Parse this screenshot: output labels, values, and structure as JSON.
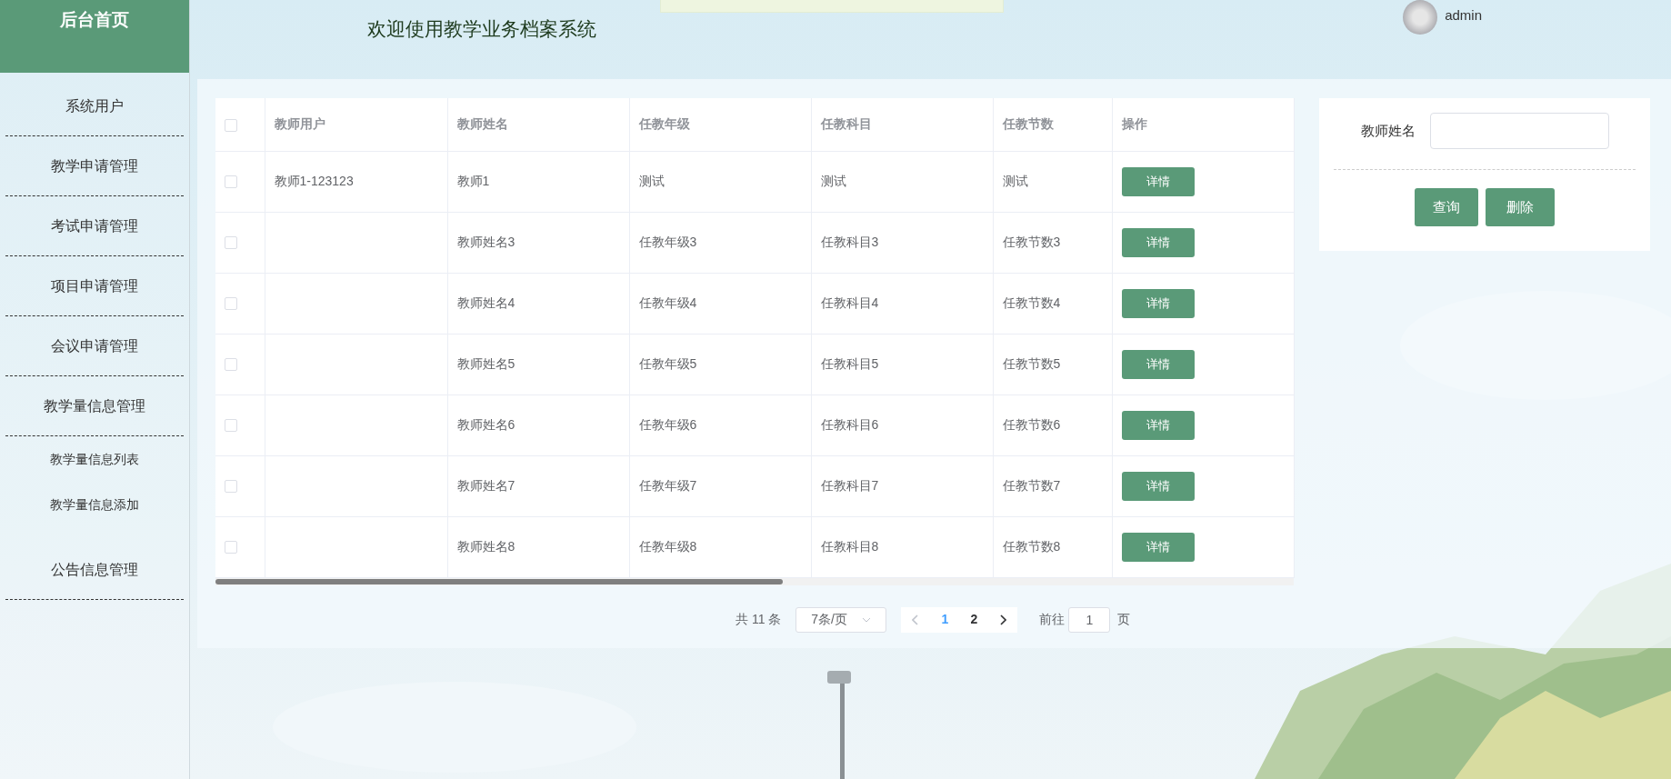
{
  "sidebar": {
    "title": "后台首页",
    "items": [
      {
        "kind": "group",
        "label": "系统用户"
      },
      {
        "kind": "group",
        "label": "教学申请管理"
      },
      {
        "kind": "group",
        "label": "考试申请管理"
      },
      {
        "kind": "group",
        "label": "项目申请管理"
      },
      {
        "kind": "group",
        "label": "会议申请管理"
      },
      {
        "kind": "group",
        "label": "教学量信息管理"
      },
      {
        "kind": "sub",
        "label": "教学量信息列表"
      },
      {
        "kind": "sub",
        "label": "教学量信息添加"
      },
      {
        "kind": "group",
        "label": "公告信息管理"
      }
    ]
  },
  "header": {
    "title": "欢迎使用教学业务档案系统",
    "user": "admin"
  },
  "table": {
    "select_all": {
      "checked": false
    },
    "columns": [
      "教师用户",
      "教师姓名",
      "任教年级",
      "任教科目",
      "任教节数",
      "操作"
    ],
    "rows": [
      {
        "checked": false,
        "user": "教师1-123123",
        "name": "教师1",
        "grade": "测试",
        "subject": "测试",
        "periods": "测试",
        "action": "详情"
      },
      {
        "checked": false,
        "name": "教师姓名3",
        "grade": "任教年级3",
        "subject": "任教科目3",
        "periods": "任教节数3",
        "action": "详情"
      },
      {
        "checked": false,
        "name": "教师姓名4",
        "grade": "任教年级4",
        "subject": "任教科目4",
        "periods": "任教节数4",
        "action": "详情"
      },
      {
        "checked": false,
        "name": "教师姓名5",
        "grade": "任教年级5",
        "subject": "任教科目5",
        "periods": "任教节数5",
        "action": "详情"
      },
      {
        "checked": false,
        "name": "教师姓名6",
        "grade": "任教年级6",
        "subject": "任教科目6",
        "periods": "任教节数6",
        "action": "详情"
      },
      {
        "checked": false,
        "name": "教师姓名7",
        "grade": "任教年级7",
        "subject": "任教科目7",
        "periods": "任教节数7",
        "action": "详情"
      },
      {
        "checked": false,
        "name": "教师姓名8",
        "grade": "任教年级8",
        "subject": "任教科目8",
        "periods": "任教节数8",
        "action": "详情"
      }
    ]
  },
  "pagination": {
    "total": "共 11 条",
    "page_size": "7条/页",
    "prev": {
      "disabled": true
    },
    "pages": [
      {
        "label": "1",
        "selected": true
      },
      {
        "label": "2",
        "selected": false
      }
    ],
    "next": {
      "disabled": false
    },
    "goto_label": "前往",
    "goto_value": "1",
    "goto_suffix": "页"
  },
  "search": {
    "label": "教师姓名",
    "buttons": [
      "查询",
      "删除"
    ]
  }
}
